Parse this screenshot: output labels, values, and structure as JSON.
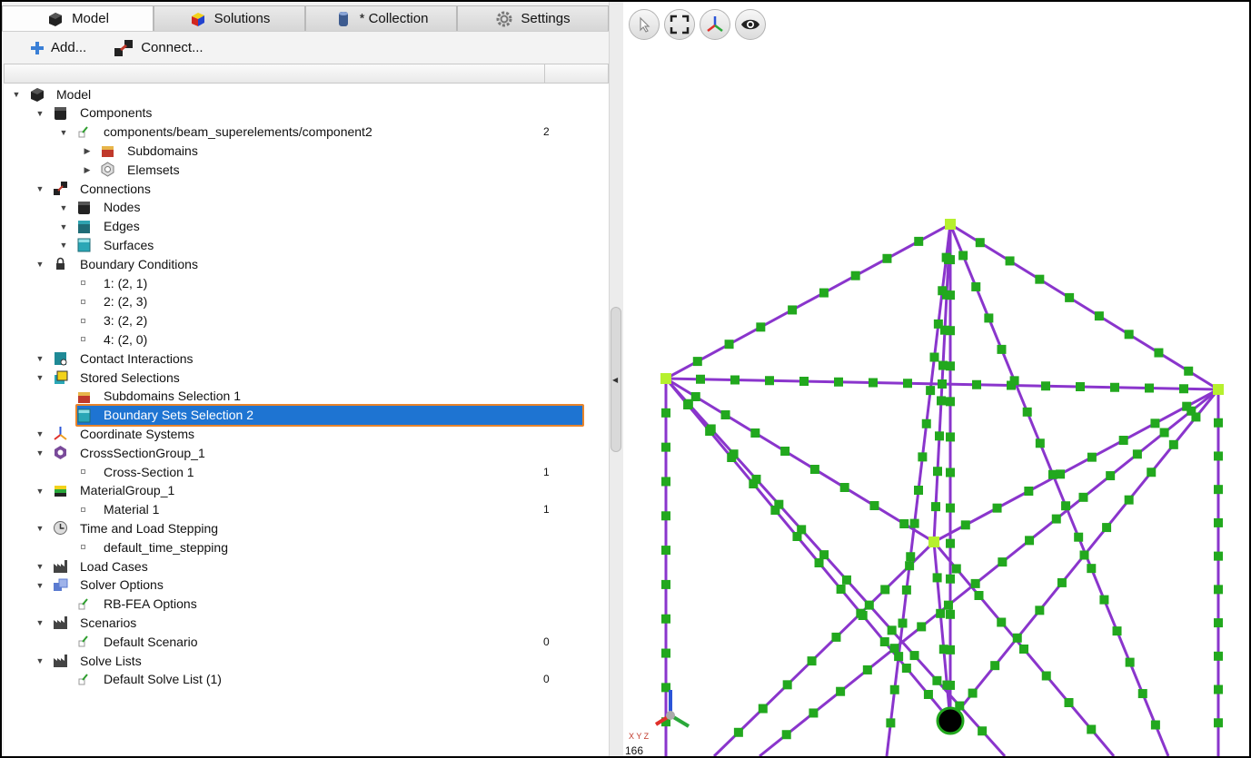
{
  "tabs": [
    {
      "label": "Model",
      "icon": "cube-icon",
      "active": true
    },
    {
      "label": "Solutions",
      "icon": "colored-cube-icon",
      "active": false
    },
    {
      "label": "* Collection",
      "icon": "database-icon",
      "active": false
    },
    {
      "label": "Settings",
      "icon": "gear-icon",
      "active": false
    }
  ],
  "toolbar": {
    "add_label": "Add...",
    "connect_label": "Connect..."
  },
  "tree": [
    {
      "label": "Model",
      "level": 0,
      "expanded": true,
      "icon": "cube-icon",
      "count": ""
    },
    {
      "label": "Components",
      "level": 1,
      "expanded": true,
      "icon": "black-cube-icon",
      "count": ""
    },
    {
      "label": "components/beam_superelements/component2",
      "level": 2,
      "expanded": true,
      "icon": "checkmark-icon",
      "count": "2"
    },
    {
      "label": "Subdomains",
      "level": 3,
      "expanded": false,
      "icon": "subdomain-cube-icon",
      "count": ""
    },
    {
      "label": "Elemsets",
      "level": 3,
      "expanded": false,
      "icon": "hexagon-icon",
      "count": ""
    },
    {
      "label": "Connections",
      "level": 1,
      "expanded": true,
      "icon": "connect-icon",
      "count": ""
    },
    {
      "label": "Nodes",
      "level": 2,
      "expanded": true,
      "icon": "black-cube-icon",
      "count": ""
    },
    {
      "label": "Edges",
      "level": 2,
      "expanded": true,
      "icon": "teal-dark-cube-icon",
      "count": ""
    },
    {
      "label": "Surfaces",
      "level": 2,
      "expanded": true,
      "icon": "teal-cube-icon",
      "count": ""
    },
    {
      "label": "Boundary Conditions",
      "level": 1,
      "expanded": true,
      "icon": "lock-icon",
      "count": ""
    },
    {
      "label": "1: (2, 1)",
      "level": 2,
      "expanded": null,
      "icon": "leaf-dot",
      "count": ""
    },
    {
      "label": "2: (2, 3)",
      "level": 2,
      "expanded": null,
      "icon": "leaf-dot",
      "count": ""
    },
    {
      "label": "3: (2, 2)",
      "level": 2,
      "expanded": null,
      "icon": "leaf-dot",
      "count": ""
    },
    {
      "label": "4: (2, 0)",
      "level": 2,
      "expanded": null,
      "icon": "leaf-dot",
      "count": ""
    },
    {
      "label": "Contact Interactions",
      "level": 1,
      "expanded": true,
      "icon": "contact-icon",
      "count": ""
    },
    {
      "label": "Stored Selections",
      "level": 1,
      "expanded": true,
      "icon": "stored-selection-icon",
      "count": ""
    },
    {
      "label": "Subdomains Selection 1",
      "level": 2,
      "expanded": null,
      "icon": "subdomain-cube-icon",
      "count": ""
    },
    {
      "label": "Boundary Sets Selection 2",
      "level": 2,
      "expanded": null,
      "icon": "teal-cube-icon",
      "count": "",
      "selected": true
    },
    {
      "label": "Coordinate Systems",
      "level": 1,
      "expanded": true,
      "icon": "axes-icon",
      "count": ""
    },
    {
      "label": "CrossSectionGroup_1",
      "level": 1,
      "expanded": true,
      "icon": "cross-section-icon",
      "count": ""
    },
    {
      "label": "Cross-Section 1",
      "level": 2,
      "expanded": null,
      "icon": "leaf-dot",
      "count": "1"
    },
    {
      "label": "MaterialGroup_1",
      "level": 1,
      "expanded": true,
      "icon": "material-icon",
      "count": ""
    },
    {
      "label": "Material 1",
      "level": 2,
      "expanded": null,
      "icon": "leaf-dot",
      "count": "1"
    },
    {
      "label": "Time and Load Stepping",
      "level": 1,
      "expanded": true,
      "icon": "clock-icon",
      "count": ""
    },
    {
      "label": "default_time_stepping",
      "level": 2,
      "expanded": null,
      "icon": "leaf-dot",
      "count": ""
    },
    {
      "label": "Load Cases",
      "level": 1,
      "expanded": true,
      "icon": "factory-icon",
      "count": ""
    },
    {
      "label": "Solver Options",
      "level": 1,
      "expanded": true,
      "icon": "solver-icon",
      "count": ""
    },
    {
      "label": "RB-FEA Options",
      "level": 2,
      "expanded": null,
      "icon": "checkmark-icon",
      "count": ""
    },
    {
      "label": "Scenarios",
      "level": 1,
      "expanded": true,
      "icon": "factory-icon",
      "count": ""
    },
    {
      "label": "Default Scenario",
      "level": 2,
      "expanded": null,
      "icon": "checkmark-icon",
      "count": "0"
    },
    {
      "label": "Solve Lists",
      "level": 1,
      "expanded": true,
      "icon": "factory-icon",
      "count": ""
    },
    {
      "label": "Default Solve List (1)",
      "level": 2,
      "expanded": null,
      "icon": "checkmark-icon",
      "count": "0"
    }
  ],
  "viewport": {
    "buttons": [
      "select-pointer-icon",
      "fit-view-icon",
      "axes-orient-icon",
      "visibility-eye-icon"
    ],
    "axis_letters": "X Y Z",
    "frame_number": "166",
    "colors": {
      "beam": "#8a35cc",
      "node": "#22a81e",
      "corner": "#b6f02e"
    }
  }
}
